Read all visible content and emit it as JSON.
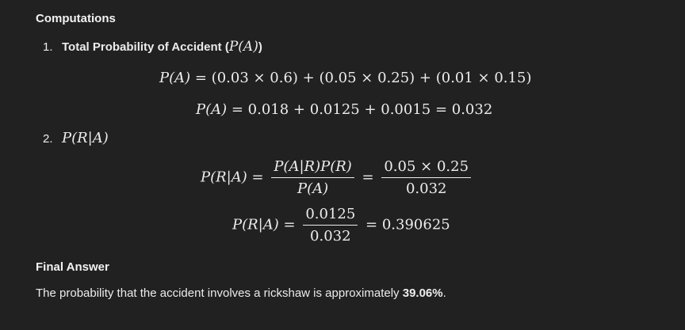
{
  "heading": "Computations",
  "item1": {
    "number": "1.",
    "label": "Total Probability of Accident (",
    "math": "P(A)",
    "close": ")"
  },
  "eq1": {
    "lhs": "P(A)",
    "rhs": " = (0.03 × 0.6) + (0.05 × 0.25) + (0.01 × 0.15)"
  },
  "eq2": {
    "lhs": "P(A)",
    "rhs": " = 0.018 + 0.0125 + 0.0015 = 0.032"
  },
  "item2": {
    "number": "2.",
    "math": "P(R|A)"
  },
  "eq3": {
    "lhs": "P(R|A) =",
    "frac1_num": "P(A|R)P(R)",
    "frac1_den": "P(A)",
    "eq_sign": "=",
    "frac2_num": "0.05 × 0.25",
    "frac2_den": "0.032"
  },
  "eq4": {
    "lhs": "P(R|A) =",
    "frac_num": "0.0125",
    "frac_den": "0.032",
    "rhs": "= 0.390625"
  },
  "final": {
    "heading": "Final Answer",
    "text": "The probability that the accident involves a rickshaw is approximately ",
    "value": "39.06%",
    "end": "."
  }
}
